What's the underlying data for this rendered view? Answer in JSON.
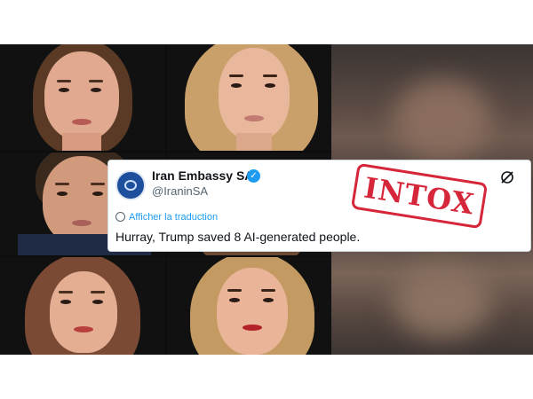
{
  "tweet": {
    "account_name": "Iran Embassy SA",
    "handle": "@IraninSA",
    "translate_label": "Afficher la traduction",
    "text": "Hurray, Trump saved 8 AI-generated people.",
    "verified_icon": "verified-badge-icon",
    "platform_icon": "x-logo-icon"
  },
  "stamp": {
    "text": "INTOX",
    "color": "#d6263a"
  },
  "colors": {
    "link_blue": "#1d9bf0",
    "verified_blue": "#1d9bf0",
    "background_black": "#0d0d0d"
  }
}
